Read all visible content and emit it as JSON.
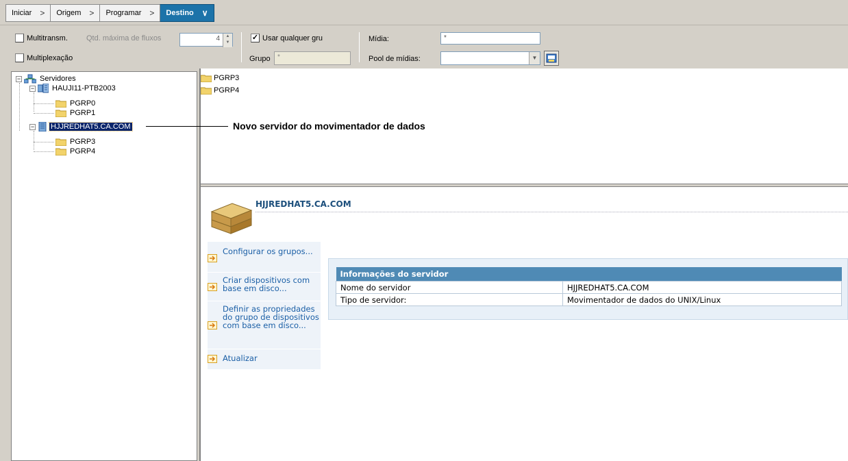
{
  "wizard": {
    "steps": [
      {
        "label": "Iniciar",
        "active": false
      },
      {
        "label": "Origem",
        "active": false
      },
      {
        "label": "Programar",
        "active": false
      },
      {
        "label": "Destino",
        "active": true
      }
    ],
    "active_color": "#1c73a9"
  },
  "options": {
    "multitransm_label": "Multitransm.",
    "multitransm_checked": false,
    "max_streams_label": "Qtd. máxima de fluxos",
    "max_streams_value": "4",
    "multiplex_label": "Multiplexação",
    "multiplex_checked": false,
    "any_group_label": "Usar qualquer gru",
    "any_group_checked": true,
    "group_label": "Grupo",
    "group_value": "*",
    "media_label": "Mídia:",
    "media_value": "*",
    "media_pool_label": "Pool de mídias:",
    "media_pool_value": ""
  },
  "tree": {
    "root": "Servidores",
    "server1": "HAUJI11-PTB2003",
    "server1_groups": [
      "PGRP0",
      "PGRP1"
    ],
    "server2": "HJJREDHAT5.CA.COM",
    "server2_groups": [
      "PGRP3",
      "PGRP4"
    ]
  },
  "list": {
    "items": [
      "PGRP3",
      "PGRP4"
    ]
  },
  "callout": "Novo servidor do movimentador de dados",
  "detail": {
    "server_title": "HJJREDHAT5.CA.COM",
    "tasks": [
      "Configurar os grupos...",
      "Criar dispositivos com base em disco...",
      "Definir as propriedades do grupo de dispositivos com base em disco...",
      "Atualizar"
    ],
    "info_header": "Informações do servidor",
    "rows": [
      {
        "label": "Nome do servidor",
        "value": "HJJREDHAT5.CA.COM"
      },
      {
        "label": "Tipo de servidor:",
        "value": "Movimentador de dados do UNIX/Linux"
      }
    ]
  }
}
